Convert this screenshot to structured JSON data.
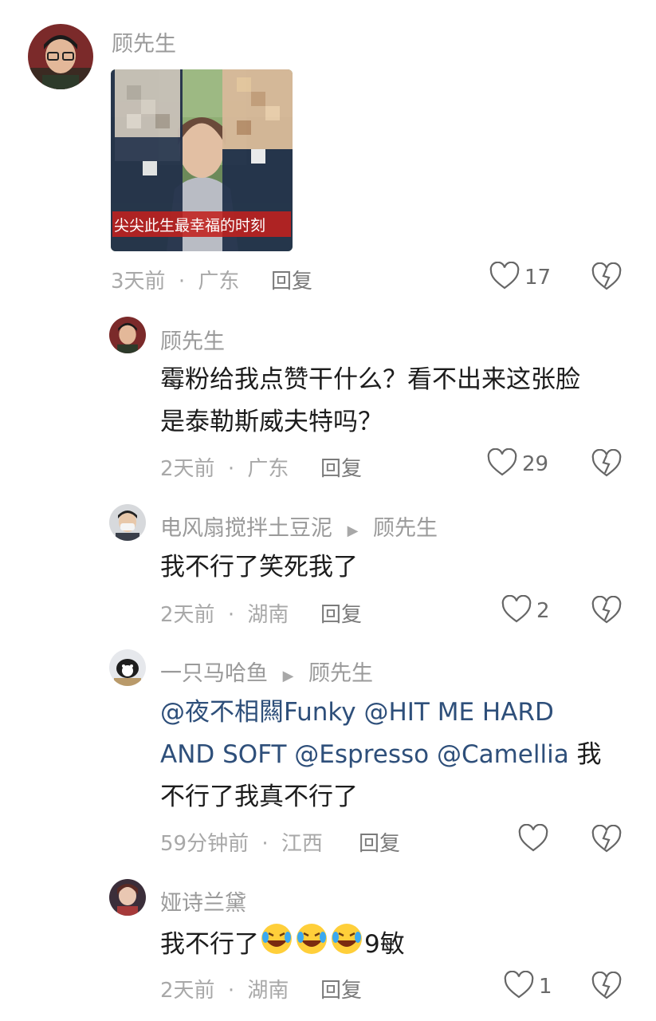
{
  "comments": [
    {
      "user": "顾先生",
      "image_caption": "尖尖此生最幸福的时刻",
      "time": "3天前",
      "location": "广东",
      "reply_label": "回复",
      "likes": "17"
    },
    {
      "user": "顾先生",
      "text_line1": "霉粉给我点赞干什么？看不出来这张脸",
      "text_line2": "是泰勒斯威夫特吗？",
      "time": "2天前",
      "location": "广东",
      "reply_label": "回复",
      "likes": "29"
    },
    {
      "user": "电风扇搅拌土豆泥",
      "reply_to": "顾先生",
      "text": "我不行了笑死我了",
      "time": "2天前",
      "location": "湖南",
      "reply_label": "回复",
      "likes": "2"
    },
    {
      "user": "一只马哈鱼",
      "reply_to": "顾先生",
      "line1_mentions": "@夜不相闗Funky @HIT ME HARD",
      "line2_mentions": "AND SOFT @Espresso @Camellia",
      "line2_text": " 我",
      "line3_text": "不行了我真不行了",
      "time": "59分钟前",
      "location": "江西",
      "reply_label": "回复",
      "likes": ""
    },
    {
      "user": "娅诗兰黛",
      "text": "我不行了",
      "text_suffix": "9敏",
      "time": "2天前",
      "location": "湖南",
      "reply_label": "回复",
      "likes": "1"
    }
  ],
  "separator": "·",
  "reply_arrow": "▶",
  "icons": {
    "like": "heart-outline-icon",
    "dislike": "broken-heart-icon",
    "emoji": "rolling-laughing-emoji"
  }
}
